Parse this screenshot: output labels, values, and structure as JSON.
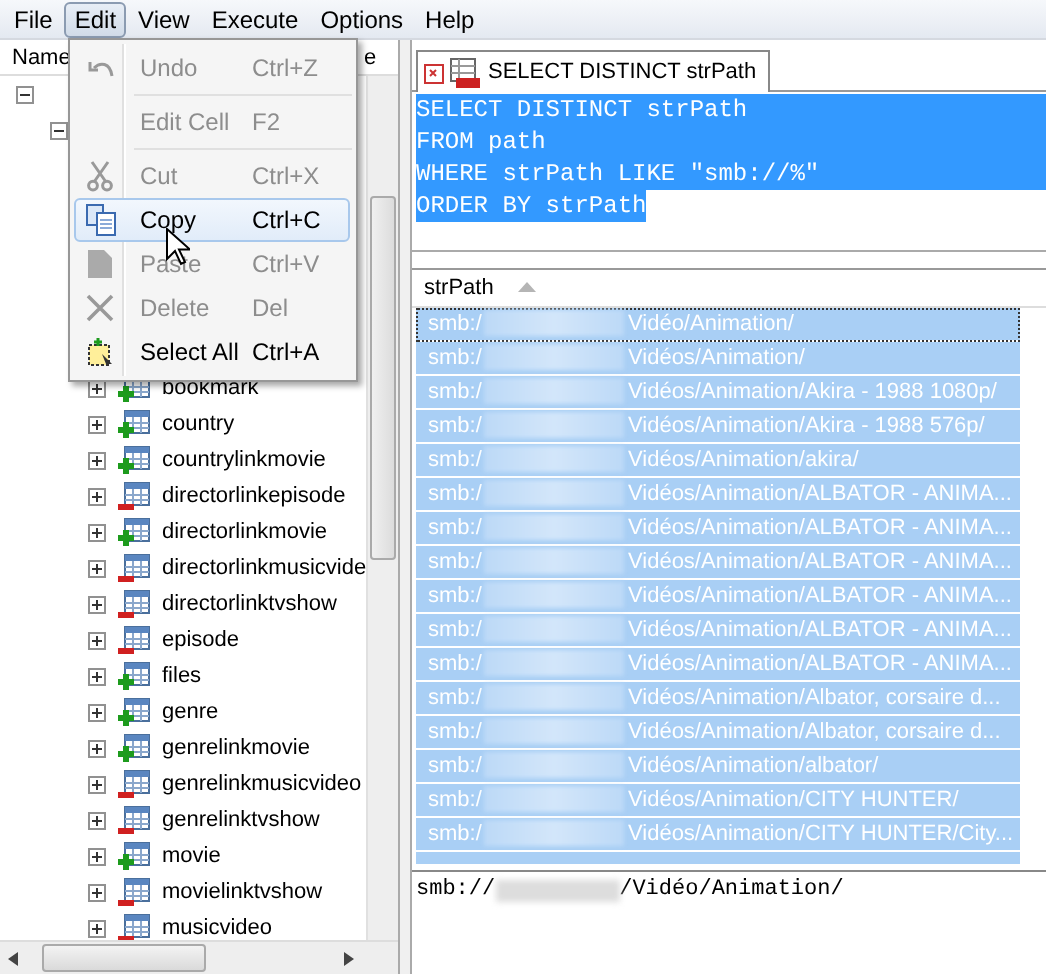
{
  "menu_bar": [
    {
      "label": "File",
      "open": false
    },
    {
      "label": "Edit",
      "open": true
    },
    {
      "label": "View",
      "open": false
    },
    {
      "label": "Execute",
      "open": false
    },
    {
      "label": "Options",
      "open": false
    },
    {
      "label": "Help",
      "open": false
    }
  ],
  "edit_menu": [
    {
      "kind": "item",
      "label": "Undo",
      "shortcut": "Ctrl+Z",
      "disabled": true,
      "hovered": false
    },
    {
      "kind": "separator"
    },
    {
      "kind": "item",
      "label": "Edit Cell",
      "shortcut": "F2",
      "disabled": true,
      "hovered": false
    },
    {
      "kind": "separator"
    },
    {
      "kind": "item",
      "label": "Cut",
      "shortcut": "Ctrl+X",
      "disabled": true,
      "hovered": false
    },
    {
      "kind": "item",
      "label": "Copy",
      "shortcut": "Ctrl+C",
      "disabled": false,
      "hovered": true
    },
    {
      "kind": "item",
      "label": "Paste",
      "shortcut": "Ctrl+V",
      "disabled": true,
      "hovered": false
    },
    {
      "kind": "item",
      "label": "Delete",
      "shortcut": "Del",
      "disabled": true,
      "hovered": false
    },
    {
      "kind": "item",
      "label": "Select All",
      "shortcut": "Ctrl+A",
      "disabled": false,
      "hovered": false
    }
  ],
  "tree": {
    "columns": [
      "Name",
      "e"
    ],
    "items": [
      {
        "label": "bookmark",
        "kind": "plus",
        "expanded": false
      },
      {
        "label": "country",
        "kind": "plus",
        "expanded": false
      },
      {
        "label": "countrylinkmovie",
        "kind": "plus",
        "expanded": false
      },
      {
        "label": "directorlinkepisode",
        "kind": "minus",
        "expanded": false
      },
      {
        "label": "directorlinkmovie",
        "kind": "plus",
        "expanded": false
      },
      {
        "label": "directorlinkmusicvide",
        "kind": "minus",
        "expanded": false
      },
      {
        "label": "directorlinktvshow",
        "kind": "minus",
        "expanded": false
      },
      {
        "label": "episode",
        "kind": "minus",
        "expanded": false
      },
      {
        "label": "files",
        "kind": "plus",
        "expanded": false
      },
      {
        "label": "genre",
        "kind": "plus",
        "expanded": false
      },
      {
        "label": "genrelinkmovie",
        "kind": "plus",
        "expanded": false
      },
      {
        "label": "genrelinkmusicvideo",
        "kind": "minus",
        "expanded": false
      },
      {
        "label": "genrelinktvshow",
        "kind": "minus",
        "expanded": false
      },
      {
        "label": "movie",
        "kind": "plus",
        "expanded": false
      },
      {
        "label": "movielinktvshow",
        "kind": "minus",
        "expanded": false
      },
      {
        "label": "musicvideo",
        "kind": "minus",
        "expanded": false
      }
    ]
  },
  "query_tab": {
    "title": "SELECT DISTINCT strPath",
    "selected": true
  },
  "sql": [
    "SELECT DISTINCT strPath",
    "FROM path",
    "WHERE strPath LIKE \"smb://%\"",
    "ORDER BY strPath"
  ],
  "grid": {
    "columns": [
      {
        "label": "strPath",
        "sort_ascending": true
      }
    ],
    "rows": [
      {
        "prefix": "smb:/",
        "suffix": "Vidéo/Animation/",
        "selected": true,
        "focused": true
      },
      {
        "prefix": "smb:/",
        "suffix": "Vidéos/Animation/",
        "selected": true,
        "focused": false
      },
      {
        "prefix": "smb:/",
        "suffix": "Vidéos/Animation/Akira - 1988 1080p/",
        "selected": true,
        "focused": false
      },
      {
        "prefix": "smb:/",
        "suffix": "Vidéos/Animation/Akira - 1988 576p/",
        "selected": true,
        "focused": false
      },
      {
        "prefix": "smb:/",
        "suffix": "Vidéos/Animation/akira/",
        "selected": true,
        "focused": false
      },
      {
        "prefix": "smb:/",
        "suffix": "Vidéos/Animation/ALBATOR - ANIMA...",
        "selected": true,
        "focused": false
      },
      {
        "prefix": "smb:/",
        "suffix": "Vidéos/Animation/ALBATOR - ANIMA...",
        "selected": true,
        "focused": false
      },
      {
        "prefix": "smb:/",
        "suffix": "Vidéos/Animation/ALBATOR - ANIMA...",
        "selected": true,
        "focused": false
      },
      {
        "prefix": "smb:/",
        "suffix": "Vidéos/Animation/ALBATOR - ANIMA...",
        "selected": true,
        "focused": false
      },
      {
        "prefix": "smb:/",
        "suffix": "Vidéos/Animation/ALBATOR - ANIMA...",
        "selected": true,
        "focused": false
      },
      {
        "prefix": "smb:/",
        "suffix": "Vidéos/Animation/ALBATOR - ANIMA...",
        "selected": true,
        "focused": false
      },
      {
        "prefix": "smb:/",
        "suffix": "Vidéos/Animation/Albator, corsaire d...",
        "selected": true,
        "focused": false
      },
      {
        "prefix": "smb:/",
        "suffix": "Vidéos/Animation/Albator, corsaire d...",
        "selected": true,
        "focused": false
      },
      {
        "prefix": "smb:/",
        "suffix": "Vidéos/Animation/albator/",
        "selected": true,
        "focused": false
      },
      {
        "prefix": "smb:/",
        "suffix": "Vidéos/Animation/CITY HUNTER/",
        "selected": true,
        "focused": false
      },
      {
        "prefix": "smb:/",
        "suffix": "Vidéos/Animation/CITY HUNTER/City...",
        "selected": true,
        "focused": false
      }
    ]
  },
  "cell_value": {
    "prefix": "smb://",
    "suffix": "/Vidéo/Animation/"
  }
}
